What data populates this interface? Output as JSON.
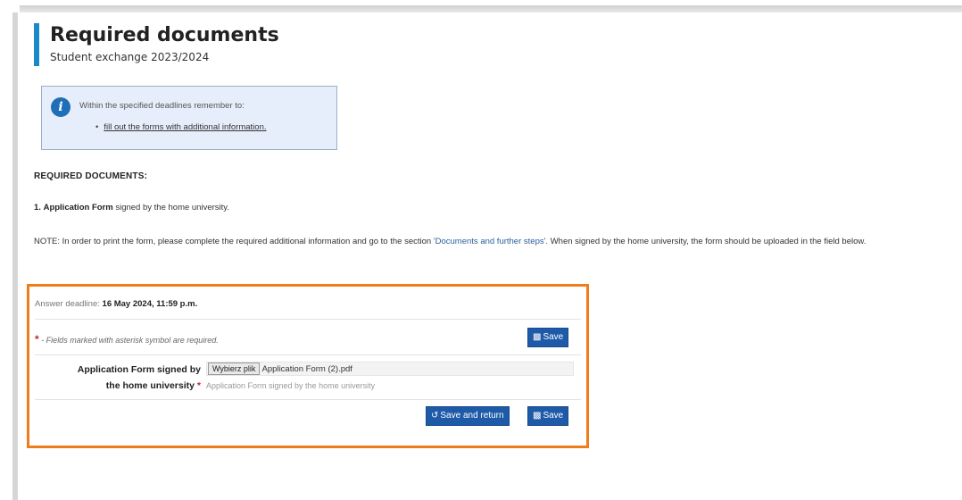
{
  "header": {
    "title": "Required documents",
    "subtitle": "Student exchange 2023/2024"
  },
  "info": {
    "text": "Within the specified deadlines remember to:",
    "bullet_link": "fill out the forms with additional information."
  },
  "content": {
    "heading": "REQUIRED DOCUMENTS:",
    "item_number": "1.",
    "item_bold": "Application Form",
    "item_rest": "signed by the home university.",
    "note_before": "NOTE: In order to print the form, please complete the required additional information and go to the section",
    "note_link": "'Documents and further steps'.",
    "note_after": "When signed by the home university, the form should be uploaded in the field below."
  },
  "form": {
    "deadline_label": "Answer deadline:",
    "deadline_value": "16 May 2024, 11:59 p.m.",
    "required_star": "*",
    "required_text": "- Fields marked with asterisk symbol are required.",
    "save_label": "Save",
    "field_label_line1": "Application Form signed by",
    "field_label_line2": "the home university",
    "choose_file_label": "Wybierz plik",
    "file_name": "Application Form (2).pdf",
    "field_help": "Application Form signed by the home university",
    "save_return_label": "Save and return",
    "save_label_2": "Save"
  },
  "colors": {
    "accent": "#1b88c7",
    "button": "#1e5aa8",
    "highlight": "#f07d1c",
    "required": "#c0272d"
  },
  "icons": [
    "info-icon",
    "floppy-disk-icon",
    "return-icon"
  ]
}
